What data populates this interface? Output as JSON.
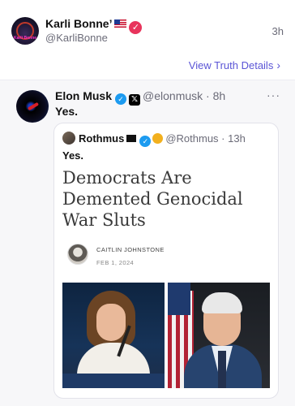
{
  "post": {
    "author_name": "Karli Bonne’",
    "handle": "@KarliBonne",
    "time": "3h",
    "avatar_text": "Karli Bonne",
    "view_details": "View Truth Details",
    "verified_color": "#e8345c"
  },
  "embedded": {
    "author_name": "Elon Musk",
    "handle_time": "@elonmusk · 8h",
    "body": "Yes.",
    "more_icon": "more-horizontal-icon",
    "verified_color": "#1d9bf0"
  },
  "quoted": {
    "author_name": "Rothmus",
    "handle_time": "@Rothmus · 13h",
    "body": "Yes.",
    "article": {
      "headline": "Democrats Are Demented Genocidal War Sluts",
      "author": "CAITLIN JOHNSTONE",
      "date": "FEB 1, 2024"
    }
  },
  "colors": {
    "link": "#5b55d6",
    "muted": "#6b6b78"
  }
}
